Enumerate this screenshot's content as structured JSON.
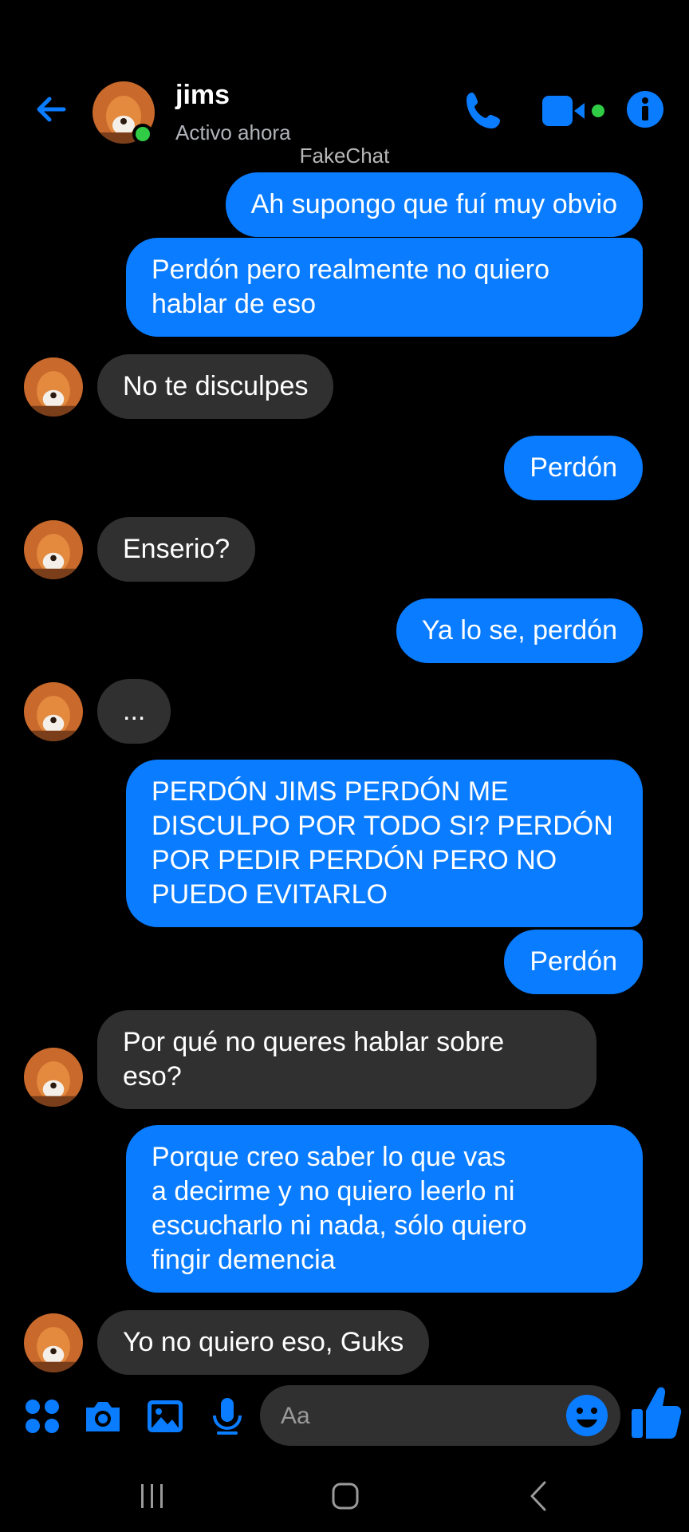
{
  "header": {
    "contact_name": "jims",
    "status": "Activo ahora",
    "watermark": "FakeChat",
    "icons": [
      "back-arrow-icon",
      "phone-icon",
      "video-camera-icon",
      "info-icon"
    ]
  },
  "messages": [
    {
      "from": "me",
      "text": "Ah supongo que fuí muy obvio"
    },
    {
      "from": "me",
      "text": "Perdón pero realmente no quiero\nhablar de eso"
    },
    {
      "from": "jims",
      "text": "No te disculpes"
    },
    {
      "from": "me",
      "text": "Perdón"
    },
    {
      "from": "jims",
      "text": "Enserio?"
    },
    {
      "from": "me",
      "text": "Ya lo se, perdón"
    },
    {
      "from": "jims",
      "text": "..."
    },
    {
      "from": "me",
      "text": "PERDÓN JIMS PERDÓN ME\nDISCULPO POR TODO SI? PERDÓN\nPOR PEDIR PERDÓN PERO NO\nPUEDO EVITARLO"
    },
    {
      "from": "me",
      "text": "Perdón"
    },
    {
      "from": "jims",
      "text": "Por qué no queres hablar sobre\neso?"
    },
    {
      "from": "me",
      "text": "Porque creo saber lo que vas\na decirme y no quiero leerlo ni\nescucharlo ni nada, sólo quiero\nfingir demencia"
    },
    {
      "from": "jims",
      "text": "Yo no quiero eso, Guks"
    }
  ],
  "composer": {
    "placeholder": "Aa",
    "icons": [
      "apps-grid-icon",
      "camera-icon",
      "gallery-icon",
      "microphone-icon",
      "emoji-icon",
      "thumbs-up-icon"
    ]
  },
  "navbar": {
    "icons": [
      "recent-apps-icon",
      "home-icon",
      "back-icon"
    ]
  },
  "colors": {
    "accent": "#0a7cff",
    "outgoing_bubble": "#0a7cff",
    "incoming_bubble": "#303030",
    "online": "#31cc46",
    "background": "#000000"
  }
}
